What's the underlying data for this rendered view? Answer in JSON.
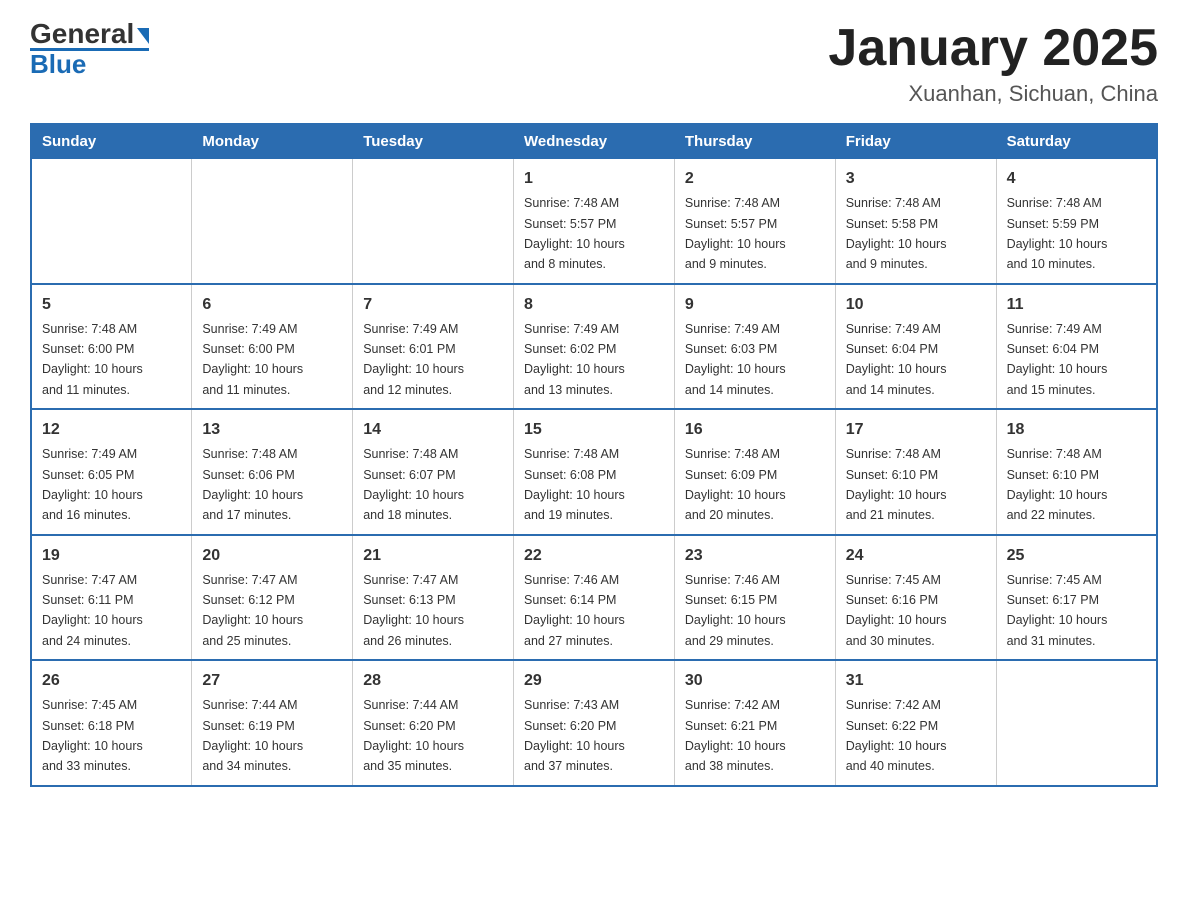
{
  "header": {
    "logo_text1": "General",
    "logo_text2": "Blue",
    "month_title": "January 2025",
    "location": "Xuanhan, Sichuan, China"
  },
  "weekdays": [
    "Sunday",
    "Monday",
    "Tuesday",
    "Wednesday",
    "Thursday",
    "Friday",
    "Saturday"
  ],
  "weeks": [
    [
      {
        "day": "",
        "info": ""
      },
      {
        "day": "",
        "info": ""
      },
      {
        "day": "",
        "info": ""
      },
      {
        "day": "1",
        "info": "Sunrise: 7:48 AM\nSunset: 5:57 PM\nDaylight: 10 hours\nand 8 minutes."
      },
      {
        "day": "2",
        "info": "Sunrise: 7:48 AM\nSunset: 5:57 PM\nDaylight: 10 hours\nand 9 minutes."
      },
      {
        "day": "3",
        "info": "Sunrise: 7:48 AM\nSunset: 5:58 PM\nDaylight: 10 hours\nand 9 minutes."
      },
      {
        "day": "4",
        "info": "Sunrise: 7:48 AM\nSunset: 5:59 PM\nDaylight: 10 hours\nand 10 minutes."
      }
    ],
    [
      {
        "day": "5",
        "info": "Sunrise: 7:48 AM\nSunset: 6:00 PM\nDaylight: 10 hours\nand 11 minutes."
      },
      {
        "day": "6",
        "info": "Sunrise: 7:49 AM\nSunset: 6:00 PM\nDaylight: 10 hours\nand 11 minutes."
      },
      {
        "day": "7",
        "info": "Sunrise: 7:49 AM\nSunset: 6:01 PM\nDaylight: 10 hours\nand 12 minutes."
      },
      {
        "day": "8",
        "info": "Sunrise: 7:49 AM\nSunset: 6:02 PM\nDaylight: 10 hours\nand 13 minutes."
      },
      {
        "day": "9",
        "info": "Sunrise: 7:49 AM\nSunset: 6:03 PM\nDaylight: 10 hours\nand 14 minutes."
      },
      {
        "day": "10",
        "info": "Sunrise: 7:49 AM\nSunset: 6:04 PM\nDaylight: 10 hours\nand 14 minutes."
      },
      {
        "day": "11",
        "info": "Sunrise: 7:49 AM\nSunset: 6:04 PM\nDaylight: 10 hours\nand 15 minutes."
      }
    ],
    [
      {
        "day": "12",
        "info": "Sunrise: 7:49 AM\nSunset: 6:05 PM\nDaylight: 10 hours\nand 16 minutes."
      },
      {
        "day": "13",
        "info": "Sunrise: 7:48 AM\nSunset: 6:06 PM\nDaylight: 10 hours\nand 17 minutes."
      },
      {
        "day": "14",
        "info": "Sunrise: 7:48 AM\nSunset: 6:07 PM\nDaylight: 10 hours\nand 18 minutes."
      },
      {
        "day": "15",
        "info": "Sunrise: 7:48 AM\nSunset: 6:08 PM\nDaylight: 10 hours\nand 19 minutes."
      },
      {
        "day": "16",
        "info": "Sunrise: 7:48 AM\nSunset: 6:09 PM\nDaylight: 10 hours\nand 20 minutes."
      },
      {
        "day": "17",
        "info": "Sunrise: 7:48 AM\nSunset: 6:10 PM\nDaylight: 10 hours\nand 21 minutes."
      },
      {
        "day": "18",
        "info": "Sunrise: 7:48 AM\nSunset: 6:10 PM\nDaylight: 10 hours\nand 22 minutes."
      }
    ],
    [
      {
        "day": "19",
        "info": "Sunrise: 7:47 AM\nSunset: 6:11 PM\nDaylight: 10 hours\nand 24 minutes."
      },
      {
        "day": "20",
        "info": "Sunrise: 7:47 AM\nSunset: 6:12 PM\nDaylight: 10 hours\nand 25 minutes."
      },
      {
        "day": "21",
        "info": "Sunrise: 7:47 AM\nSunset: 6:13 PM\nDaylight: 10 hours\nand 26 minutes."
      },
      {
        "day": "22",
        "info": "Sunrise: 7:46 AM\nSunset: 6:14 PM\nDaylight: 10 hours\nand 27 minutes."
      },
      {
        "day": "23",
        "info": "Sunrise: 7:46 AM\nSunset: 6:15 PM\nDaylight: 10 hours\nand 29 minutes."
      },
      {
        "day": "24",
        "info": "Sunrise: 7:45 AM\nSunset: 6:16 PM\nDaylight: 10 hours\nand 30 minutes."
      },
      {
        "day": "25",
        "info": "Sunrise: 7:45 AM\nSunset: 6:17 PM\nDaylight: 10 hours\nand 31 minutes."
      }
    ],
    [
      {
        "day": "26",
        "info": "Sunrise: 7:45 AM\nSunset: 6:18 PM\nDaylight: 10 hours\nand 33 minutes."
      },
      {
        "day": "27",
        "info": "Sunrise: 7:44 AM\nSunset: 6:19 PM\nDaylight: 10 hours\nand 34 minutes."
      },
      {
        "day": "28",
        "info": "Sunrise: 7:44 AM\nSunset: 6:20 PM\nDaylight: 10 hours\nand 35 minutes."
      },
      {
        "day": "29",
        "info": "Sunrise: 7:43 AM\nSunset: 6:20 PM\nDaylight: 10 hours\nand 37 minutes."
      },
      {
        "day": "30",
        "info": "Sunrise: 7:42 AM\nSunset: 6:21 PM\nDaylight: 10 hours\nand 38 minutes."
      },
      {
        "day": "31",
        "info": "Sunrise: 7:42 AM\nSunset: 6:22 PM\nDaylight: 10 hours\nand 40 minutes."
      },
      {
        "day": "",
        "info": ""
      }
    ]
  ]
}
